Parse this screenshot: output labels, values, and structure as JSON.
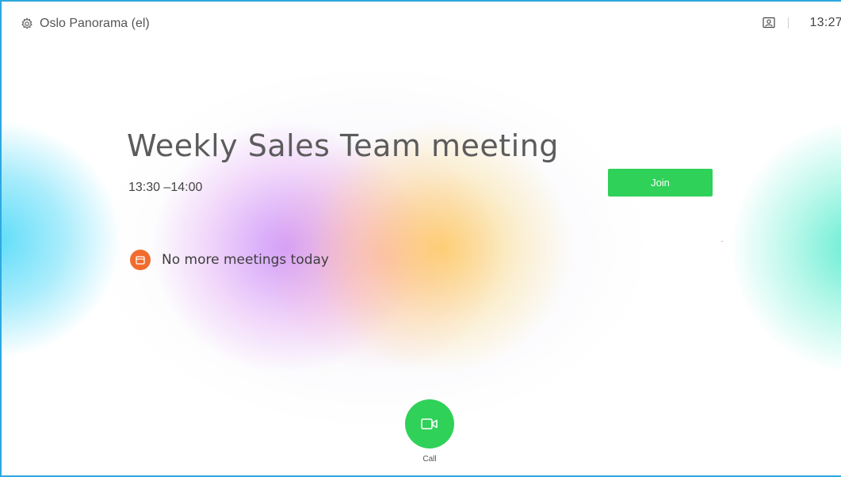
{
  "header": {
    "room_name": "Oslo Panorama (el)",
    "time": "13:27"
  },
  "meeting": {
    "title": "Weekly Sales Team meeting",
    "time_range": "13:30 –14:00",
    "join_label": "Join"
  },
  "status": {
    "message": "No more meetings today"
  },
  "call": {
    "label": "Call"
  },
  "icons": {
    "settings": "gear-icon",
    "self_view": "self-view-icon",
    "calendar": "calendar-icon",
    "video": "video-camera-icon"
  },
  "colors": {
    "frame_border": "#2ea8e0",
    "accent_green": "#2fd158",
    "status_orange": "#f26b2e"
  }
}
